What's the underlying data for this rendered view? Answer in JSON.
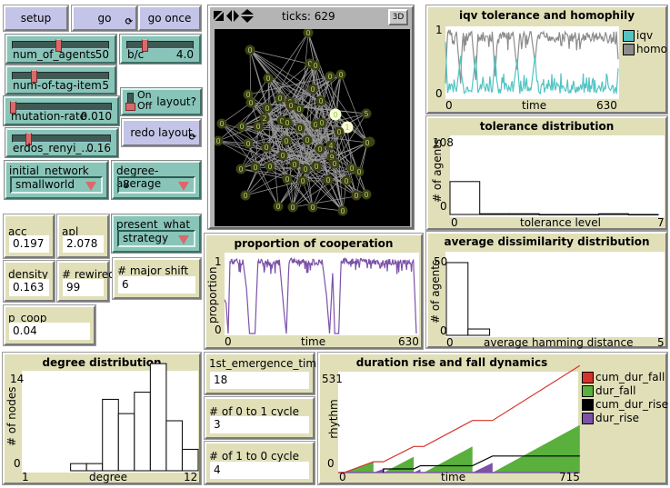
{
  "buttons": {
    "setup": "setup",
    "go": "go",
    "go_once": "go once",
    "redo_layout": "redo layout",
    "forever_icon": "⟳"
  },
  "sliders": [
    {
      "id": "num_of_agents",
      "label": "num_of_agents",
      "value": "50",
      "fraction": 0.4
    },
    {
      "id": "b_c",
      "label": "b/c",
      "value": "4.0",
      "fraction": 0.25
    },
    {
      "id": "num_of_tag_item",
      "label": "num-of-tag-item",
      "value": "5",
      "fraction": 0.2
    },
    {
      "id": "mutation_rate",
      "label": "mutation-rate",
      "value": "0.010",
      "fraction": 0.0
    },
    {
      "id": "erdos_renyi",
      "label": "erdos_renyi_...",
      "value": "0.16",
      "fraction": 0.15
    }
  ],
  "switch": {
    "label": "layout?",
    "on": "On",
    "off": "Off",
    "state": "off"
  },
  "choosers": {
    "initial_network": {
      "label": "initial_network",
      "value": "smallworld"
    },
    "degree_average": {
      "label": "degree-average",
      "value": "8"
    },
    "present_what": {
      "label": "present_what",
      "value": "strategy"
    }
  },
  "monitors": {
    "acc": {
      "label": "acc",
      "value": "0.197"
    },
    "apl": {
      "label": "apl",
      "value": "2.078"
    },
    "density": {
      "label": "density",
      "value": "0.163"
    },
    "rewired": {
      "label": "# rewired",
      "value": "99"
    },
    "major_shift": {
      "label": "# major shift",
      "value": "6"
    },
    "p_coop": {
      "label": "p_coop",
      "value": "0.04"
    },
    "first_emergence": {
      "label": "1st_emergence_time",
      "value": "18"
    },
    "cycle_0_1": {
      "label": "# of 0 to 1 cycle",
      "value": "3"
    },
    "cycle_1_0": {
      "label": "# of 1 to 0 cycle",
      "value": "4"
    }
  },
  "view": {
    "ticks_label": "ticks: 629",
    "three_d": "3D",
    "node_labels_highlight": [
      "0",
      "1"
    ],
    "node_label_other": [
      "2",
      "5",
      "4",
      "9"
    ]
  },
  "colors": {
    "iqv": "#52c4c4",
    "homo": "#8c8c8c",
    "coop": "#7c51a8",
    "cum_dur_fall": "#d73229",
    "dur_fall": "#59b03c",
    "cum_dur_rise": "#000000",
    "dur_rise": "#7c51a8",
    "node": "#404016",
    "node_label": "#9cd46a"
  },
  "chart_data": [
    {
      "id": "iqv",
      "type": "line",
      "title": "iqv tolerance and homophily",
      "xlabel": "time",
      "ylabel": "",
      "xlim": [
        0,
        630
      ],
      "ylim": [
        0,
        1
      ],
      "x_ticks": [
        "0",
        "630"
      ],
      "y_ticks": [
        "0",
        "1"
      ],
      "legend": [
        "iqv",
        "homo"
      ],
      "legend_position": "right",
      "series": [
        {
          "name": "homo",
          "segments": [
            [
              0,
              0.2
            ],
            [
              8,
              1
            ],
            [
              40,
              0.95
            ],
            [
              55,
              0.2
            ],
            [
              62,
              0.95
            ],
            [
              95,
              0.95
            ],
            [
              110,
              0.25
            ],
            [
              118,
              0.95
            ],
            [
              170,
              0.95
            ],
            [
              180,
              0.3
            ],
            [
              190,
              0.95
            ],
            [
              245,
              0.95
            ],
            [
              260,
              0.4
            ],
            [
              270,
              0.95
            ],
            [
              310,
              0.95
            ],
            [
              325,
              0.5
            ],
            [
              335,
              0.95
            ],
            [
              620,
              0.95
            ],
            [
              630,
              0.35
            ]
          ]
        },
        {
          "name": "iqv",
          "segments": [
            [
              0,
              0.8
            ],
            [
              8,
              0.05
            ],
            [
              40,
              0.08
            ],
            [
              55,
              0.6
            ],
            [
              62,
              0.05
            ],
            [
              95,
              0.08
            ],
            [
              110,
              0.6
            ],
            [
              118,
              0.05
            ],
            [
              170,
              0.08
            ],
            [
              180,
              0.6
            ],
            [
              190,
              0.05
            ],
            [
              245,
              0.08
            ],
            [
              260,
              0.55
            ],
            [
              270,
              0.05
            ],
            [
              310,
              0.1
            ],
            [
              325,
              0.6
            ],
            [
              335,
              0.05
            ],
            [
              620,
              0.05
            ],
            [
              630,
              0.6
            ]
          ]
        }
      ]
    },
    {
      "id": "tolerance",
      "type": "bar",
      "title": "tolerance distribution",
      "xlabel": "tolerance level",
      "ylabel": "# of agents",
      "xlim": [
        0,
        7
      ],
      "ylim": [
        0,
        108
      ],
      "x_ticks": [
        "0",
        "7"
      ],
      "y_ticks": [
        "0",
        "108"
      ],
      "bins": [
        [
          0,
          1,
          46
        ],
        [
          1,
          2,
          1
        ],
        [
          2,
          3,
          1
        ],
        [
          3,
          4,
          0
        ],
        [
          4,
          5,
          0
        ],
        [
          5,
          6,
          1
        ],
        [
          6,
          7,
          0
        ]
      ]
    },
    {
      "id": "coop",
      "type": "line",
      "title": "proportion of cooperation",
      "xlabel": "time",
      "ylabel": "proportion",
      "xlim": [
        0,
        630
      ],
      "ylim": [
        0,
        1
      ],
      "x_ticks": [
        "0",
        "630"
      ],
      "y_ticks": [
        "0",
        "1"
      ],
      "series": [
        {
          "name": "cooperation",
          "points": [
            [
              0,
              0.45
            ],
            [
              5,
              0.4
            ],
            [
              12,
              0.0
            ],
            [
              18,
              1
            ],
            [
              60,
              0.98
            ],
            [
              72,
              0.6
            ],
            [
              82,
              0.0
            ],
            [
              100,
              0.0
            ],
            [
              110,
              1
            ],
            [
              180,
              0.98
            ],
            [
              195,
              0.3
            ],
            [
              203,
              0.0
            ],
            [
              212,
              1
            ],
            [
              320,
              0.98
            ],
            [
              335,
              0.5
            ],
            [
              345,
              0.0
            ],
            [
              355,
              0.8
            ],
            [
              362,
              0.0
            ],
            [
              375,
              0.0
            ],
            [
              383,
              1
            ],
            [
              620,
              0.98
            ],
            [
              630,
              0.0
            ]
          ]
        }
      ]
    },
    {
      "id": "dissimilarity",
      "type": "bar",
      "title": "average dissimilarity distribution",
      "xlabel": "average hamming distance",
      "ylabel": "# of agents",
      "xlim": [
        0,
        5
      ],
      "ylim": [
        0,
        50
      ],
      "x_ticks": [
        "0",
        "5"
      ],
      "y_ticks": [
        "0",
        "50"
      ],
      "bins": [
        [
          0,
          0.5,
          46
        ],
        [
          0.5,
          1,
          4
        ]
      ]
    },
    {
      "id": "degree",
      "type": "bar",
      "title": "degree distribution",
      "xlabel": "degree",
      "ylabel": "# of nodes",
      "xlim": [
        1,
        12
      ],
      "ylim": [
        0,
        14
      ],
      "x_ticks": [
        "1",
        "12"
      ],
      "y_ticks": [
        "0",
        "14"
      ],
      "bins": [
        [
          4,
          5,
          1
        ],
        [
          5,
          6,
          1
        ],
        [
          6,
          7,
          10
        ],
        [
          7,
          8,
          8
        ],
        [
          8,
          9,
          11
        ],
        [
          9,
          10,
          15
        ],
        [
          10,
          11,
          7
        ],
        [
          11,
          12,
          3
        ]
      ]
    },
    {
      "id": "duration",
      "type": "line",
      "title": "duration rise and fall dynamics",
      "xlabel": "time",
      "ylabel": "rhythm",
      "xlim": [
        0,
        715
      ],
      "ylim": [
        0,
        531
      ],
      "x_ticks": [
        "0",
        "715"
      ],
      "y_ticks": [
        "0",
        "531"
      ],
      "legend": [
        "cum_dur_fall",
        "dur_fall",
        "cum_dur_rise",
        "dur_rise"
      ],
      "legend_position": "right",
      "series": [
        {
          "name": "cum_dur_fall",
          "points": [
            [
              0,
              0
            ],
            [
              18,
              0
            ],
            [
              105,
              60
            ],
            [
              135,
              60
            ],
            [
              225,
              145
            ],
            [
              255,
              145
            ],
            [
              400,
              290
            ],
            [
              460,
              290
            ],
            [
              720,
              595
            ]
          ]
        },
        {
          "name": "dur_fall",
          "areas": [
            [
              [
                18,
                0
              ],
              [
                105,
                60
              ],
              [
                105,
                0
              ]
            ],
            [
              [
                135,
                0
              ],
              [
                225,
                88
              ],
              [
                225,
                0
              ]
            ],
            [
              [
                255,
                0
              ],
              [
                400,
                145
              ],
              [
                400,
                0
              ]
            ],
            [
              [
                460,
                0
              ],
              [
                720,
                265
              ],
              [
                720,
                0
              ]
            ]
          ]
        },
        {
          "name": "cum_dur_rise",
          "points": [
            [
              135,
              0
            ],
            [
              135,
              20
            ],
            [
              225,
              20
            ],
            [
              245,
              38
            ],
            [
              400,
              38
            ],
            [
              460,
              92
            ],
            [
              720,
              92
            ]
          ]
        },
        {
          "name": "dur_rise",
          "areas": [
            [
              [
                105,
                0
              ],
              [
                135,
                20
              ],
              [
                135,
                0
              ]
            ],
            [
              [
                225,
                0
              ],
              [
                245,
                18
              ],
              [
                245,
                0
              ]
            ],
            [
              [
                400,
                0
              ],
              [
                460,
                54
              ],
              [
                460,
                0
              ]
            ]
          ]
        }
      ]
    }
  ]
}
